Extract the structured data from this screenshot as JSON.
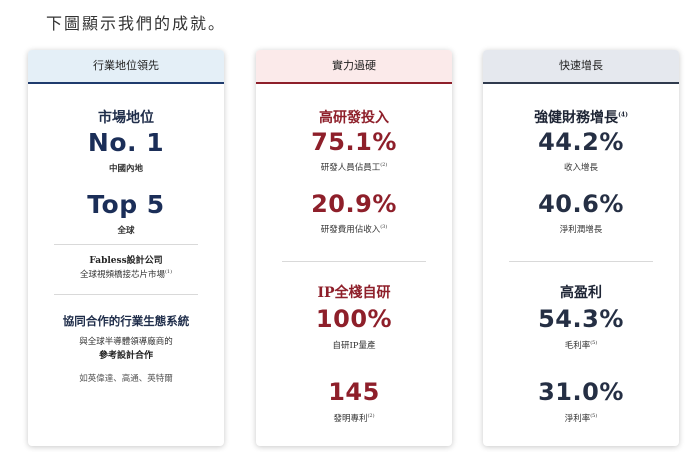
{
  "intro": "下圖顯示我們的成就。",
  "cards": [
    {
      "header": "行業地位領先",
      "header_bg": "#e4eff7",
      "header_line": "#1f3b6d",
      "title": "市場地位",
      "stat1_value": "No. 1",
      "stat1_caption": "中國內地",
      "stat2_value": "Top 5",
      "stat2_caption": "全球",
      "fabless_title": "Fabless設計公司",
      "fabless_desc": "全球視頻橋接芯片市場",
      "fabless_sup": "(1)",
      "eco_title": "協同合作的行業生態系統",
      "eco_line1": "與全球半導體領導廠商的",
      "eco_line2": "參考設計合作",
      "partners": "如英偉達、高通、英特爾"
    },
    {
      "header": "實力過硬",
      "header_bg": "#fbeaea",
      "header_line": "#8e1f2a",
      "title1": "高研發投入",
      "stat1_value": "75.1%",
      "stat1_caption": "研發人員佔員工",
      "stat1_sup": "(2)",
      "stat2_value": "20.9%",
      "stat2_caption": "研發費用佔收入",
      "stat2_sup": "(3)",
      "title2": "IP全棧自研",
      "stat3_value": "100%",
      "stat3_caption": "自研IP量產",
      "stat4_value": "145",
      "stat4_caption": "發明專利",
      "stat4_sup": "(2)"
    },
    {
      "header": "快速增長",
      "header_bg": "#e5e8ee",
      "header_line": "#2f3a4d",
      "title1": "強健財務增長",
      "title1_sup": "(4)",
      "stat1_value": "44.2%",
      "stat1_caption": "收入增長",
      "stat2_value": "40.6%",
      "stat2_caption": "淨利潤增長",
      "title2": "高盈利",
      "stat3_value": "54.3%",
      "stat3_caption": "毛利率",
      "stat3_sup": "(5)",
      "stat4_value": "31.0%",
      "stat4_caption": "淨利率",
      "stat4_sup": "(5)"
    }
  ]
}
